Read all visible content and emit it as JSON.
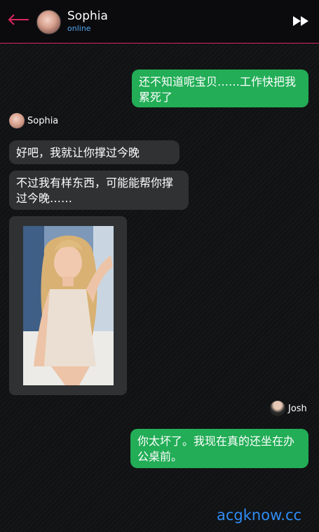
{
  "header": {
    "name": "Sophia",
    "status": "online",
    "accent_color": "#d9265e",
    "status_color": "#52a8f0"
  },
  "icons": {
    "back": "left-arrow-icon",
    "skip": "fast-forward-icon"
  },
  "messages": [
    {
      "from": "user",
      "text": "还不知道呢宝贝……工作快把我累死了"
    },
    {
      "from": "sophia",
      "sender": "Sophia",
      "text": "好吧，我就让你撑过今晚"
    },
    {
      "from": "sophia",
      "text": "不过我有样东西，可能能帮你撑过今晚……"
    },
    {
      "from": "sophia",
      "type": "image"
    },
    {
      "from": "user",
      "sender": "Josh",
      "text": "你太坏了。我现在真的还坐在办公桌前。"
    }
  ],
  "colors": {
    "user_bubble": "#22ad56",
    "assistant_bubble": "#2f3133"
  },
  "watermark": "acgknow.cc"
}
